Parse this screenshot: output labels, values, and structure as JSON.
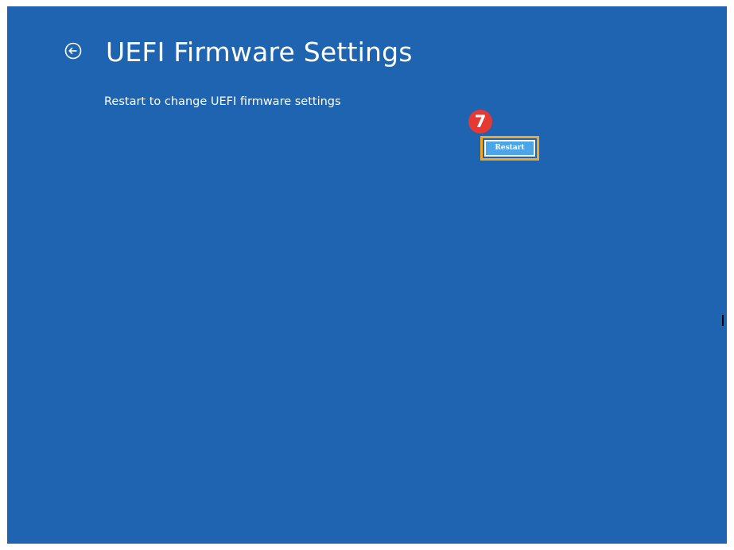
{
  "page": {
    "title": "UEFI Firmware Settings",
    "description": "Restart to change UEFI firmware settings"
  },
  "actions": {
    "restart_label": "Restart"
  },
  "annotation": {
    "step_number": "7"
  },
  "icons": {
    "back": "back-arrow-circle-icon"
  },
  "colors": {
    "background": "#1e64b1",
    "button": "#4ca5e8",
    "highlight": "#f5a623",
    "badge": "#e53935"
  }
}
